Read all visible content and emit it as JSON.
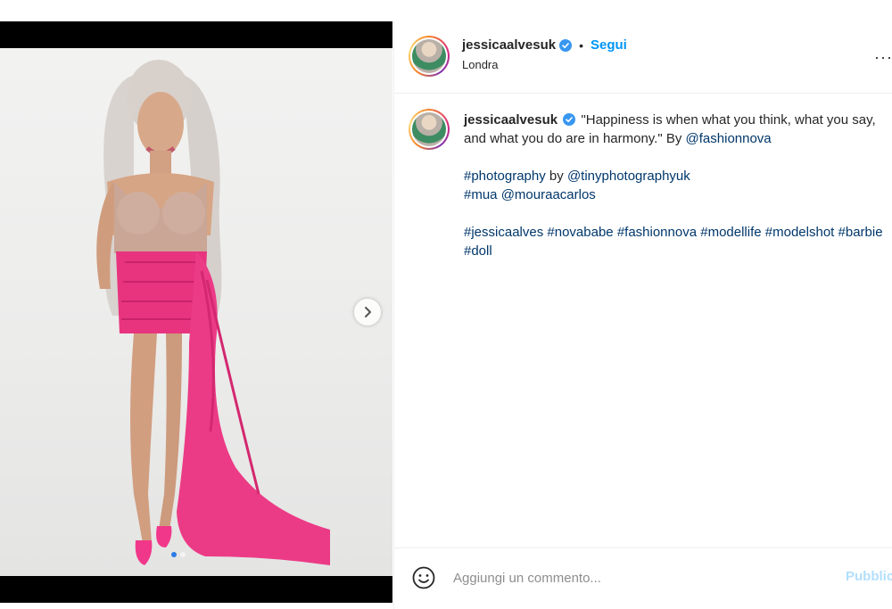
{
  "post": {
    "username": "jessicaalvesuk",
    "separator": "•",
    "follow_label": "Segui",
    "location": "Londra",
    "more_label": "···",
    "carousel": {
      "total": 2,
      "active_index": 0
    }
  },
  "caption": {
    "username": "jessicaalvesuk",
    "quote": "\"Happiness is when what you think, what you say, and what you do are in harmony.\" By ",
    "mention_fashionnova": "@fashionnova",
    "tag_photography": "#photography",
    "by_word": " by ",
    "mention_photographer": "@tinyphotographyuk",
    "tag_mua": "#mua",
    "mention_mua": "@mouraacarlos",
    "tags": [
      "#jessicaalves",
      "#novababe",
      "#fashionnova",
      "#modellife",
      "#modelshot",
      "#barbie",
      "#doll"
    ]
  },
  "comment": {
    "placeholder": "Aggiungi un commento...",
    "publish_label": "Pubblica"
  },
  "colors": {
    "accent": "#0095f6",
    "link": "#00376b",
    "publish_disabled": "#b2dffc",
    "dress_pink": "#e8347f"
  }
}
